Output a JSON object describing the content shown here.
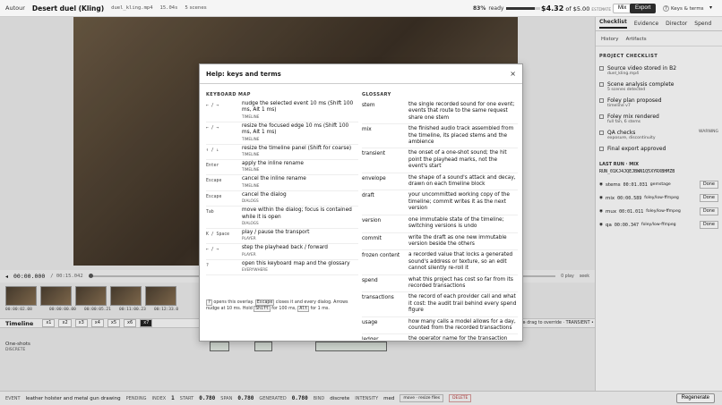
{
  "topbar": {
    "author": "Autour",
    "project": "Desert duel (Kling)",
    "file": "duel_kling.mp4",
    "duration": "15.04s",
    "scenes": "5 scenes",
    "ready_pct": "83%",
    "ready_label": "ready",
    "ready_fraction": 0.83,
    "spent": "$4.32",
    "budget_of": "of $5.00",
    "budget_note": "ESTIMATE",
    "mix_label": "Mix",
    "export_label": "Export",
    "keys_badge": "?",
    "keys_label": "Keys & terms"
  },
  "player": {
    "timecode": "00:00.000",
    "duration": "/ 00:15.042",
    "play_label": "0 play",
    "seek_label": "seek"
  },
  "thumbs": [
    "00:00:02.08",
    "00:00:00.00",
    "00:00:05.21",
    "00:11:00.23",
    "00:12:33.0"
  ],
  "timeline": {
    "title": "Timeline",
    "zooms": [
      "x1",
      "x2",
      "x3",
      "x4",
      "x5",
      "x6",
      "x7"
    ],
    "active_zoom": 6,
    "hint": "snap 10 ms · ⊕ drag to override · TRANSIENT • START • 50 MS BIAS · move · resize · rename · delete line",
    "track_label": "One-shots",
    "track_sub": "DISCRETE"
  },
  "footer": {
    "event_label": "EVENT",
    "event_name": "leather holster and metal gun drawing",
    "status": "PENDING",
    "index_label": "INDEX",
    "index": "1",
    "start_label": "START",
    "start": "0.780",
    "span_label": "SPAN",
    "span": "0.780",
    "generated_label": "GENERATED",
    "generated": "0.780",
    "bind_label": "BIND",
    "bind": "discrete",
    "intensity_label": "INTENSITY",
    "intensity": "med",
    "tag_move": "move · resize files",
    "tag_delete": "DELETE",
    "regenerate": "Regenerate"
  },
  "right_panel": {
    "tabs": [
      "Checklist",
      "Evidence",
      "Director",
      "Spend"
    ],
    "subtabs": [
      "History",
      "Artifacts"
    ],
    "section": "PROJECT CHECKLIST",
    "items": [
      {
        "title": "Source video stored in B2",
        "detail": "duel_kling.mp4"
      },
      {
        "title": "Scene analysis complete",
        "detail": "5 scenes detected"
      },
      {
        "title": "Foley plan proposed",
        "detail": "timeline v7"
      },
      {
        "title": "Foley mix rendered",
        "detail": "full fan, 6 stems"
      },
      {
        "title": "QA checks",
        "detail": "exposure, discontinuity",
        "warn": "WARNING"
      },
      {
        "title": "Final export approved",
        "detail": ""
      }
    ],
    "last_run_label": "LAST RUN · MIX",
    "run_id": "RUN_01KJ4JQEJBWN1Q5XYRXBHMZB",
    "runs": [
      {
        "name": "stems",
        "time": "00:01.031",
        "detail": "gemstage",
        "done": "Done"
      },
      {
        "name": "mix",
        "time": "00:00.589",
        "detail": "foley/low-ffmpeg",
        "done": "Done"
      },
      {
        "name": "mux",
        "time": "00:01.011",
        "detail": "foley/low-ffmpeg",
        "done": "Done"
      },
      {
        "name": "qa",
        "time": "00:00.347",
        "detail": "foley/low-ffmpeg",
        "done": "Done"
      }
    ]
  },
  "modal": {
    "title": "Help: keys and terms",
    "close": "×",
    "keyboard_heading": "KEYBOARD MAP",
    "glossary_heading": "GLOSSARY",
    "keys": [
      {
        "key": "← / →",
        "desc": "nudge the selected event 10 ms (Shift 100 ms, Alt 1 ms)",
        "scope": "TIMELINE"
      },
      {
        "key": "← / →",
        "desc": "resize the focused edge 10 ms (Shift 100 ms, Alt 1 ms)",
        "scope": "TIMELINE"
      },
      {
        "key": "↑ / ↓",
        "desc": "resize the timeline panel (Shift for coarse)",
        "scope": "TIMELINE"
      },
      {
        "key": "Enter",
        "desc": "apply the inline rename",
        "scope": "TIMELINE"
      },
      {
        "key": "Escape",
        "desc": "cancel the inline rename",
        "scope": "TIMELINE"
      },
      {
        "key": "Escape",
        "desc": "cancel the dialog",
        "scope": "DIALOGS"
      },
      {
        "key": "Tab",
        "desc": "move within the dialog; focus is contained while it is open",
        "scope": "DIALOGS"
      },
      {
        "key": "K / Space",
        "desc": "play / pause the transport",
        "scope": "PLAYER"
      },
      {
        "key": "← / →",
        "desc": "step the playhead back / forward",
        "scope": "PLAYER"
      },
      {
        "key": "?",
        "desc": "open this keyboard map and the glossary",
        "scope": "EVERYWHERE"
      }
    ],
    "note_a": "?",
    "note_b": "opens this overlay.",
    "note_c": "Escape",
    "note_d": "closes it and every dialog. Arrows nudge at 10 ms. Hold",
    "note_e": "Shift",
    "note_f": "for 100 ms,",
    "note_g": "Alt",
    "note_h": "for 1 ms.",
    "glossary": [
      {
        "term": "stem",
        "def": "the single recorded sound for one event; events that route to the same request share one stem"
      },
      {
        "term": "mix",
        "def": "the finished audio track assembled from the timeline, its placed stems and the ambience"
      },
      {
        "term": "transient",
        "def": "the onset of a one-shot sound; the hit point the playhead marks, not the event's start"
      },
      {
        "term": "envelope",
        "def": "the shape of a sound's attack and decay, drawn on each timeline block"
      },
      {
        "term": "draft",
        "def": "your uncommitted working copy of the timeline; commit writes it as the next version"
      },
      {
        "term": "version",
        "def": "one immutable state of the timeline; switching versions is undo"
      },
      {
        "term": "commit",
        "def": "write the draft as one new immutable version beside the others"
      },
      {
        "term": "frozen content",
        "def": "a recorded value that locks a generated sound's address or texture, so an edit cannot silently re-roll it"
      },
      {
        "term": "spend",
        "def": "what this project has cost so far from its recorded transactions"
      },
      {
        "term": "transactions",
        "def": "the record of each provider call and what it cost: the audit trail behind every spend figure"
      },
      {
        "term": "usage",
        "def": "how many calls a model allows for a day, counted from the recorded transactions"
      },
      {
        "term": "ledger",
        "def": "the operator name for the transaction record every billed call is written to"
      }
    ]
  }
}
